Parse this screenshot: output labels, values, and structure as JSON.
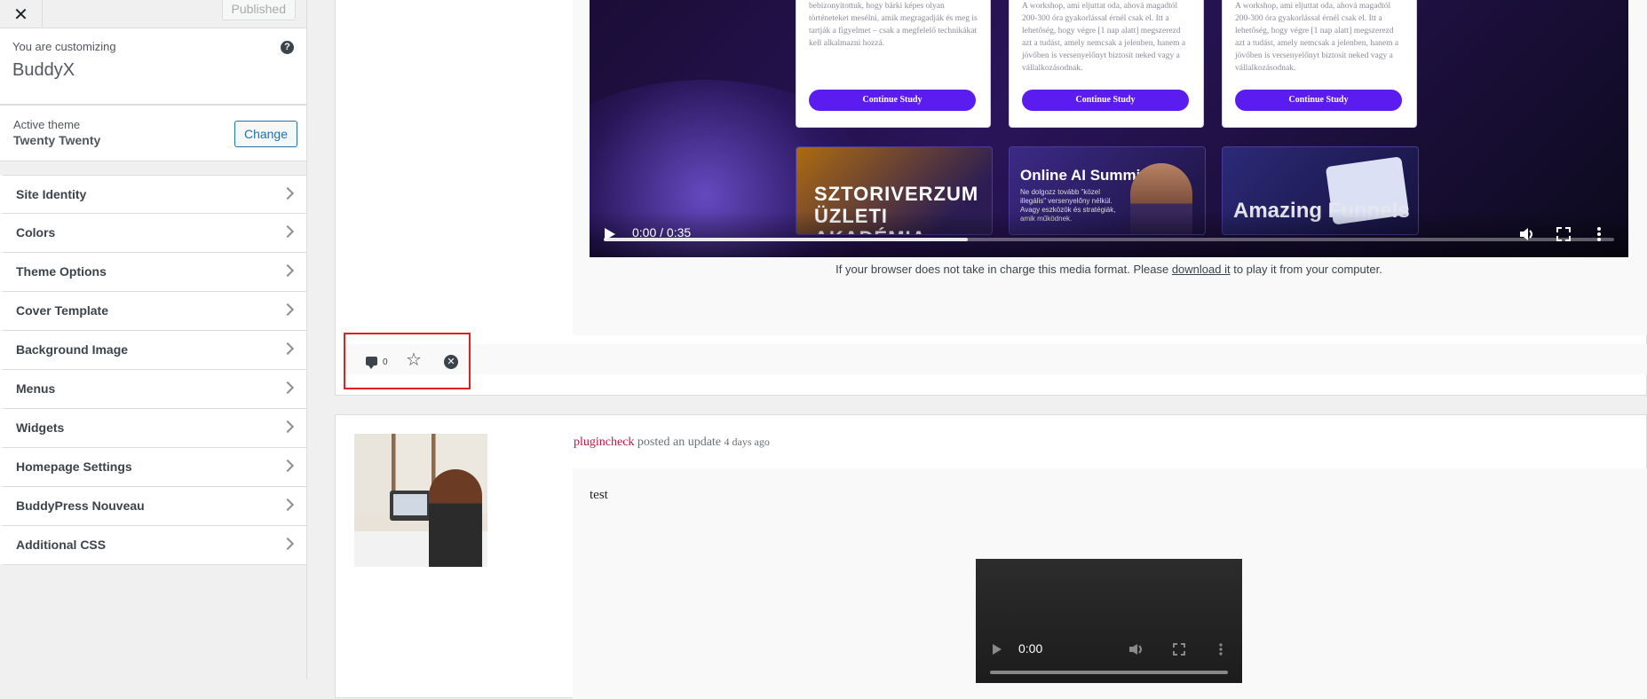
{
  "customizer": {
    "close_label": "✕",
    "published_label": "Published",
    "customizing_label": "You are customizing",
    "site_title": "BuddyX",
    "help_label": "?",
    "active_theme_label": "Active theme",
    "active_theme_name": "Twenty Twenty",
    "change_label": "Change",
    "menu": [
      {
        "label": "Site Identity"
      },
      {
        "label": "Colors"
      },
      {
        "label": "Theme Options"
      },
      {
        "label": "Cover Template"
      },
      {
        "label": "Background Image"
      },
      {
        "label": "Menus"
      },
      {
        "label": "Widgets"
      },
      {
        "label": "Homepage Settings"
      },
      {
        "label": "BuddyPress Nouveau"
      },
      {
        "label": "Additional CSS"
      }
    ]
  },
  "preview": {
    "video1": {
      "cards": [
        {
          "text": "bebizonyítottuk, hogy bárki képes olyan történeteket mesélni, amik megragadják és meg is tartják a figyelmet – csak a megfelelő technikákat kell alkalmazni hozzá.",
          "button": "Continue Study"
        },
        {
          "text": "A workshop, ami eljuttat oda, ahová magadtól 200-300 óra gyakorlással érnél csak el. Itt a lehetőség, hogy végre [1 nap alatt] megszerezd azt a tudást, amely nemcsak a jelenben, hanem a jövőben is versenyelőnyt biztosít neked vagy a vállalkozásodnak.",
          "button": "Continue Study"
        },
        {
          "text": "A workshop, ami eljuttat oda, ahová magadtól 200-300 óra gyakorlással érnél csak el. Itt a lehetőség, hogy végre [1 nap alatt] megszerezd azt a tudást, amely nemcsak a jelenben, hanem a jövőben is versenyelőnyt biztosít neked vagy a vállalkozásodnak.",
          "button": "Continue Study"
        }
      ],
      "promos": [
        {
          "title": "SZTORIVERZUM ÜZLETI AKADÉMIA"
        },
        {
          "title": "Online AI Summit",
          "subtitle": "Ne dolgozz tovább \"közel illegális\" versenyelőny nélkül. Avagy eszközök és stratégiák, amik működnek."
        },
        {
          "title": "Amazing Funnels"
        }
      ],
      "time_display": "0:00 / 0:35",
      "buffered_fraction": 0.36
    },
    "media_note_pre": "If your browser does not take in charge this media format. Please ",
    "media_note_link": "download it",
    "media_note_post": " to play it from your computer.",
    "comment_count": "0",
    "activity2": {
      "username": "plugincheck",
      "action": " posted an update ",
      "time_ago": "4 days ago",
      "text": "test",
      "video_time": "0:00"
    }
  },
  "colors": {
    "accent": "#2271b1",
    "highlight": "#e02020",
    "study_button": "#5b1cf0",
    "username": "#c0133f"
  }
}
